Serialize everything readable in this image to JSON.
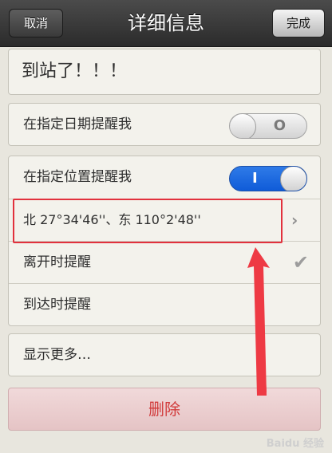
{
  "navbar": {
    "cancel_label": "取消",
    "title": "详细信息",
    "done_label": "完成"
  },
  "title_row": {
    "text": "到站了！！！"
  },
  "date_remind": {
    "label": "在指定日期提醒我",
    "toggle_state": "O"
  },
  "location_remind": {
    "label": "在指定位置提醒我",
    "toggle_state": "I",
    "location": "北 27°34'46''、东 110°2'48''"
  },
  "leave_remind": {
    "label": "离开时提醒"
  },
  "arrive_remind": {
    "label": "到达时提醒"
  },
  "more": {
    "label": "显示更多…"
  },
  "delete": {
    "label": "删除"
  },
  "watermark": {
    "text": "Baidu 经验"
  },
  "colors": {
    "toggle_on": "#1a69e0",
    "highlight": "#e2313d",
    "delete_text": "#d13a3a"
  }
}
